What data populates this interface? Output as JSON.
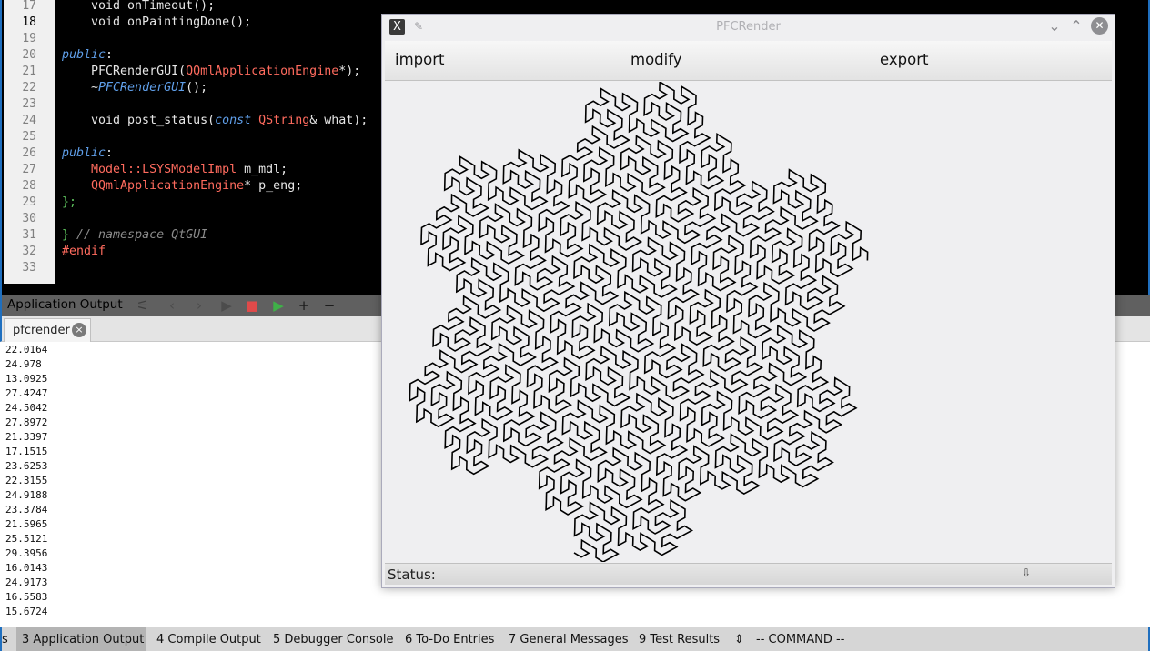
{
  "editor": {
    "lines": [
      {
        "n": "17",
        "segs": [
          [
            "plain",
            "    void onTimeout();"
          ]
        ]
      },
      {
        "n": "18",
        "segs": [
          [
            "plain",
            "    void onPaintingDone();"
          ]
        ],
        "current": true
      },
      {
        "n": "19",
        "segs": []
      },
      {
        "n": "20",
        "segs": [
          [
            "pub",
            "public"
          ],
          [
            "plain",
            ":"
          ]
        ]
      },
      {
        "n": "21",
        "segs": [
          [
            "plain",
            "    PFCRenderGUI("
          ],
          [
            "ty",
            "QQmlApplicationEngine"
          ],
          [
            "plain",
            "*);"
          ]
        ]
      },
      {
        "n": "22",
        "segs": [
          [
            "plain",
            "    ~"
          ],
          [
            "kw",
            "PFCRenderGUI"
          ],
          [
            "plain",
            "();"
          ]
        ]
      },
      {
        "n": "23",
        "segs": []
      },
      {
        "n": "24",
        "segs": [
          [
            "plain",
            "    void post_status("
          ],
          [
            "kw",
            "const"
          ],
          [
            "plain",
            " "
          ],
          [
            "ty",
            "QString"
          ],
          [
            "plain",
            "& what);"
          ]
        ]
      },
      {
        "n": "25",
        "segs": []
      },
      {
        "n": "26",
        "segs": [
          [
            "pub",
            "public"
          ],
          [
            "plain",
            ":"
          ]
        ]
      },
      {
        "n": "27",
        "segs": [
          [
            "plain",
            "    "
          ],
          [
            "ty",
            "Model::LSYSModelImpl"
          ],
          [
            "plain",
            " m_mdl;"
          ]
        ]
      },
      {
        "n": "28",
        "segs": [
          [
            "plain",
            "    "
          ],
          [
            "ty",
            "QQmlApplicationEngine"
          ],
          [
            "plain",
            "* p_eng;"
          ]
        ]
      },
      {
        "n": "29",
        "segs": [
          [
            "br",
            "};"
          ]
        ]
      },
      {
        "n": "30",
        "segs": []
      },
      {
        "n": "31",
        "segs": [
          [
            "br",
            "}"
          ],
          [
            "cm",
            " // namespace QtGUI"
          ]
        ]
      },
      {
        "n": "32",
        "segs": [
          [
            "ty",
            "#endif"
          ]
        ]
      },
      {
        "n": "33",
        "segs": []
      }
    ]
  },
  "output_pane": {
    "title": "Application Output",
    "tab_label": "pfcrender",
    "tab_close": "×",
    "values": [
      "22.0164",
      "24.978",
      "13.0925",
      "27.4247",
      "24.5042",
      "27.8972",
      "21.3397",
      "17.1515",
      "23.6253",
      "22.3155",
      "24.9188",
      "23.3784",
      "21.5965",
      "25.5121",
      "29.3956",
      "16.0143",
      "24.9173",
      "16.5583",
      "15.6724"
    ]
  },
  "bottom_bar": {
    "edge": "s",
    "items": [
      "3  Application Output",
      "4  Compile Output",
      "5  Debugger Console",
      "6  To-Do Entries",
      "7  General Messages",
      "9  Test Results"
    ],
    "arrows": "⇕",
    "command": "-- COMMAND --"
  },
  "pfc_window": {
    "title": "PFCRender",
    "app_icon": "X",
    "menu": {
      "import": "import",
      "modify": "modify",
      "export": "export"
    },
    "status_label": "Status:",
    "grip": "⇩"
  },
  "colors": {
    "editor_bg": "#000000",
    "keyword": "#5f9ee8",
    "type": "#ff6b5e",
    "comment": "#8a8a8a",
    "curve": "#000000"
  }
}
